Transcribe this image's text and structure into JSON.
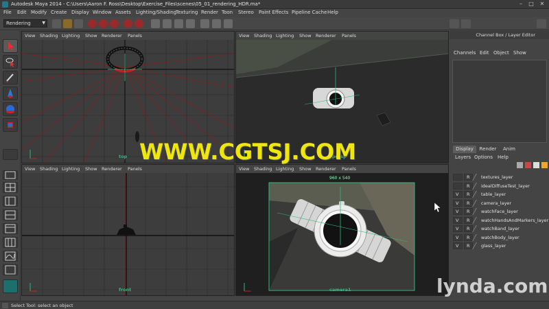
{
  "window": {
    "title": "Autodesk Maya 2014 -   C:\\Users\\Aaron F. Ross\\Desktop\\Exercise_Files\\scenes\\05_01_rendering_HDR.ma*",
    "controls": {
      "minimize": "–",
      "maximize": "□",
      "close": "✕"
    }
  },
  "menubar": [
    "File",
    "Edit",
    "Modify",
    "Create",
    "Display",
    "Window",
    "Assets",
    "Lighting/Shading",
    "Texturing",
    "Render",
    "Toon",
    "Stereo",
    "Paint Effects",
    "Pipeline Cache",
    "Help"
  ],
  "shelf": {
    "mode_selector": "Rendering"
  },
  "viewport_menu": [
    "View",
    "Shading",
    "Lighting",
    "Show",
    "Renderer",
    "Panels"
  ],
  "viewports": {
    "top": {
      "label": "top"
    },
    "persp": {
      "label": "persp"
    },
    "front": {
      "label": "front"
    },
    "camera1": {
      "label": "camera1",
      "resolution": "960 x 540"
    }
  },
  "channel_box": {
    "header": "Channel Box / Layer Editor",
    "menu": [
      "Channels",
      "Edit",
      "Object",
      "Show"
    ]
  },
  "layer_editor": {
    "tabs": [
      "Display",
      "Render",
      "Anim"
    ],
    "active_tab": "Display",
    "menu": [
      "Layers",
      "Options",
      "Help"
    ],
    "layers": [
      {
        "v": "",
        "r": "R",
        "name": "textures_layer"
      },
      {
        "v": "",
        "r": "R",
        "name": "idealDiffuseTest_layer"
      },
      {
        "v": "V",
        "r": "R",
        "name": "table_layer"
      },
      {
        "v": "V",
        "r": "R",
        "name": "camera_layer"
      },
      {
        "v": "V",
        "r": "R",
        "name": "watchFace_layer"
      },
      {
        "v": "V",
        "r": "R",
        "name": "watchHandsAndMarkers_layer"
      },
      {
        "v": "V",
        "r": "R",
        "name": "watchBand_layer"
      },
      {
        "v": "V",
        "r": "R",
        "name": "watchBody_layer"
      },
      {
        "v": "V",
        "r": "R",
        "name": "glass_layer"
      }
    ]
  },
  "status_bar": {
    "text": "Select Tool: select an object"
  },
  "overlays": {
    "watermark": "WWW.CGTSJ.COM",
    "brand": "lynda.com"
  },
  "colors": {
    "grid_green": "#2fb87a",
    "watermark_yellow": "#f0e60f",
    "selection_red": "#c81e1e"
  }
}
